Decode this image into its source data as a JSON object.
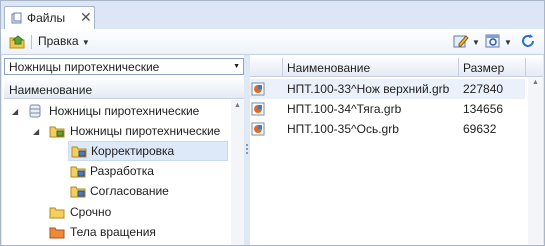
{
  "tab": {
    "title": "Файлы",
    "close_glyph": "✕",
    "icon": "folder-tab-icon"
  },
  "toolbar": {
    "menu_label": "Правка",
    "icons": [
      "home-folder-icon",
      "edit-icon",
      "view-options-icon",
      "refresh-icon"
    ]
  },
  "left": {
    "selector_value": "Ножницы пиротехнические",
    "column_header": "Наименование",
    "tree": [
      {
        "label": "Ножницы пиротехнические",
        "icon": "database-icon"
      },
      {
        "label": "Ножницы пиротехнические",
        "icon": "folder-multi-icon"
      },
      {
        "label": "Корректировка",
        "icon": "folder-multi-icon"
      },
      {
        "label": "Разработка",
        "icon": "folder-multi-icon"
      },
      {
        "label": "Согласование",
        "icon": "folder-multi-icon"
      },
      {
        "label": "Срочно",
        "icon": "folder-yellow-icon"
      },
      {
        "label": "Тела вращения",
        "icon": "folder-orange-icon"
      }
    ]
  },
  "right": {
    "columns": [
      "Наименование",
      "Размер"
    ],
    "rows": [
      {
        "name": "НПТ.100-33^Нож верхний.grb",
        "size": "227840"
      },
      {
        "name": "НПТ.100-34^Тяга.grb",
        "size": "134656"
      },
      {
        "name": "НПТ.100-35^Ось.grb",
        "size": "69632"
      }
    ]
  },
  "colors": {
    "accent": "#4a78c2",
    "selection": "#dde8f8",
    "chrome": "#dfe8f5"
  }
}
